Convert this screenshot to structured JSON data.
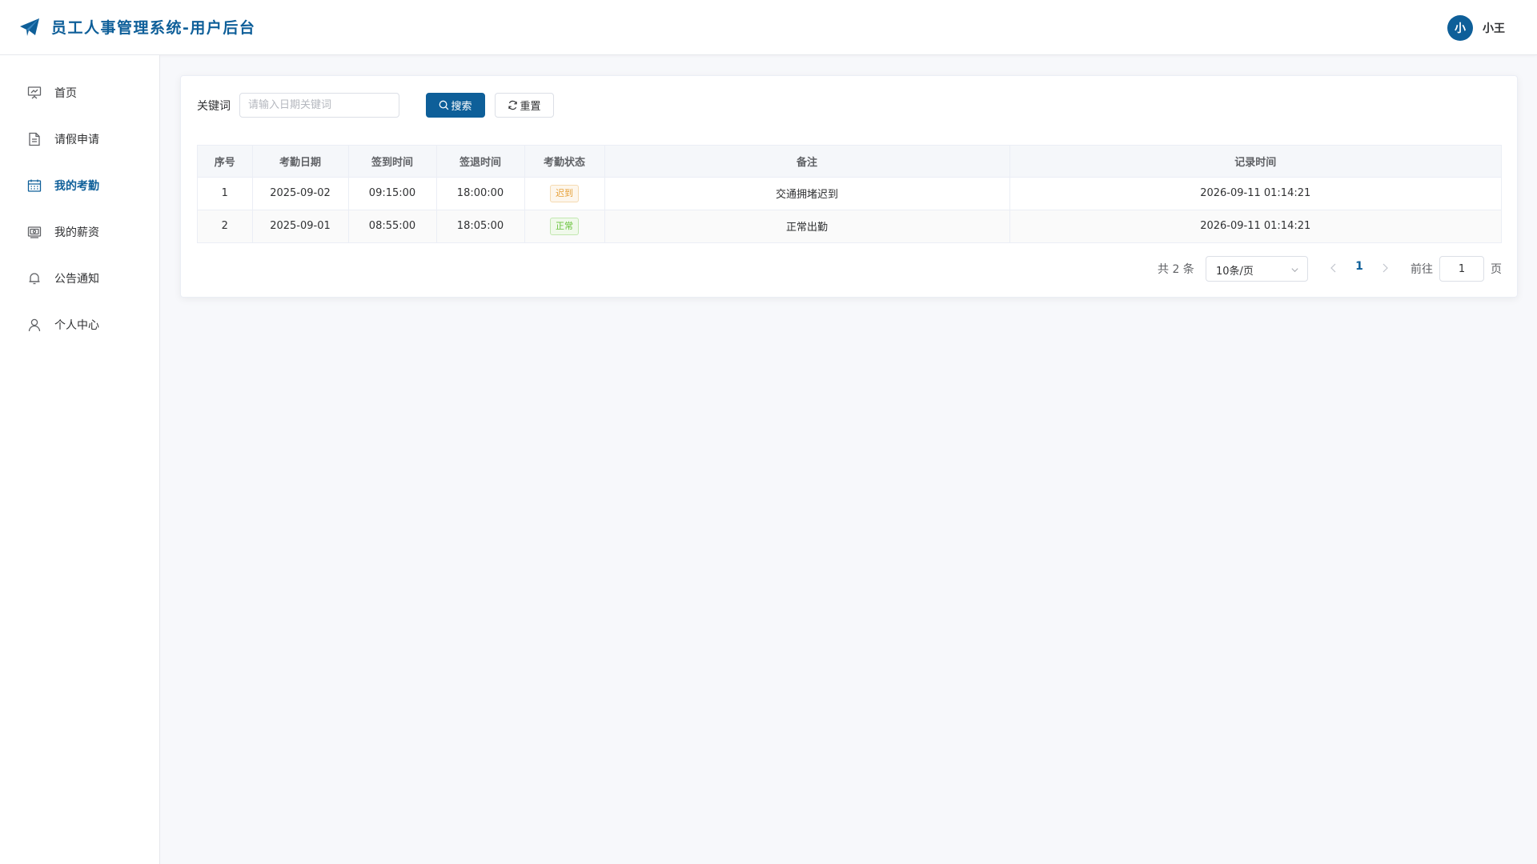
{
  "header": {
    "title": "员工人事管理系统-用户后台",
    "avatar_char": "小",
    "username": "小王"
  },
  "sidebar": {
    "items": [
      {
        "label": "首页",
        "icon": "presentation-icon",
        "active": false
      },
      {
        "label": "请假申请",
        "icon": "document-icon",
        "active": false
      },
      {
        "label": "我的考勤",
        "icon": "calendar-icon",
        "active": true
      },
      {
        "label": "我的薪资",
        "icon": "money-icon",
        "active": false
      },
      {
        "label": "公告通知",
        "icon": "bell-icon",
        "active": false
      },
      {
        "label": "个人中心",
        "icon": "user-icon",
        "active": false
      }
    ]
  },
  "search": {
    "label": "关键词",
    "placeholder": "请输入日期关键词",
    "value": "",
    "search_label": "搜索",
    "reset_label": "重置"
  },
  "table": {
    "columns": [
      "序号",
      "考勤日期",
      "签到时间",
      "签退时间",
      "考勤状态",
      "备注",
      "记录时间"
    ],
    "rows": [
      {
        "index": "1",
        "date": "2025-09-02",
        "sign_in": "09:15:00",
        "sign_out": "18:00:00",
        "status": "迟到",
        "status_type": "warning",
        "remark": "交通拥堵迟到",
        "record_time": "2026-09-11 01:14:21"
      },
      {
        "index": "2",
        "date": "2025-09-01",
        "sign_in": "08:55:00",
        "sign_out": "18:05:00",
        "status": "正常",
        "status_type": "success",
        "remark": "正常出勤",
        "record_time": "2026-09-11 01:14:21"
      }
    ]
  },
  "pagination": {
    "total_text": "共 2 条",
    "page_size": "10条/页",
    "current_page": "1",
    "goto_label": "前往",
    "goto_value": "1",
    "page_suffix": "页"
  },
  "colors": {
    "primary": "#0e5f99",
    "warning": "#e6a23c",
    "success": "#67c23a"
  }
}
